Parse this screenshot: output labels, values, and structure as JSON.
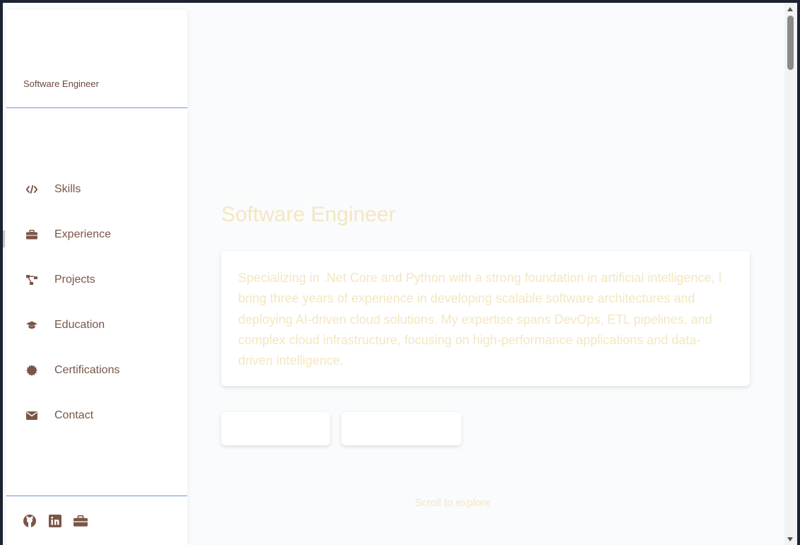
{
  "sidebar": {
    "role": "Software Engineer",
    "items": [
      {
        "label": "Skills",
        "icon": "code-icon"
      },
      {
        "label": "Experience",
        "icon": "briefcase-icon"
      },
      {
        "label": "Projects",
        "icon": "project-diagram-icon"
      },
      {
        "label": "Education",
        "icon": "graduation-cap-icon"
      },
      {
        "label": "Certifications",
        "icon": "certificate-icon"
      },
      {
        "label": "Contact",
        "icon": "envelope-icon"
      }
    ],
    "social": [
      "github-icon",
      "linkedin-icon",
      "briefcase-icon"
    ]
  },
  "main": {
    "title": "Software Engineer",
    "summary": "Specializing in .Net Core and Python with a strong foundation in artificial intelligence, I bring three years of experience in developing scalable software architectures and deploying AI-driven cloud solutions. My expertise spans DevOps, ETL pipelines, and complex cloud infrastructure, focusing on high-performance applications and data-driven intelligence.",
    "scroll_hint": "Scroll to explore"
  },
  "colors": {
    "accent_text": "#7a5648",
    "faded_text": "#f3e7c2",
    "divider": "#6e93df",
    "frame": "#1b2330"
  }
}
